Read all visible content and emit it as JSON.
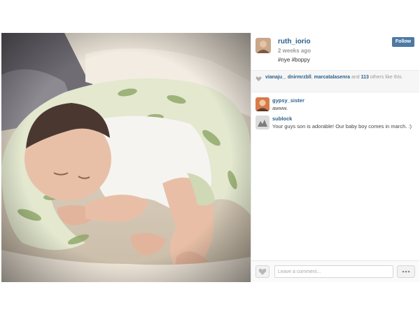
{
  "post": {
    "username": "ruth_iorio",
    "time": "2 weeks ago",
    "caption": "#nye #boppy",
    "follow_label": "Follow"
  },
  "likes": {
    "user1": "vianaju_",
    "user2": "dnirmrzbll",
    "user3": "marcatalasenra",
    "and_text": "and",
    "others_count": "113",
    "others_text": "others like this."
  },
  "comments": [
    {
      "user": "gypsy_sister",
      "text": "awww."
    },
    {
      "user": "sublock",
      "text": "Your guys son is adorable! Our baby boy comes in march. :)"
    }
  ],
  "footer": {
    "comment_placeholder": "Leave a comment..."
  },
  "icons": {
    "like": "heart-icon",
    "more": "ellipsis-icon",
    "likes_marker": "heart-icon"
  },
  "colors": {
    "link": "#2a5f8a",
    "follow_button": "#4d79a3",
    "meta_text": "#9a9a9a"
  }
}
